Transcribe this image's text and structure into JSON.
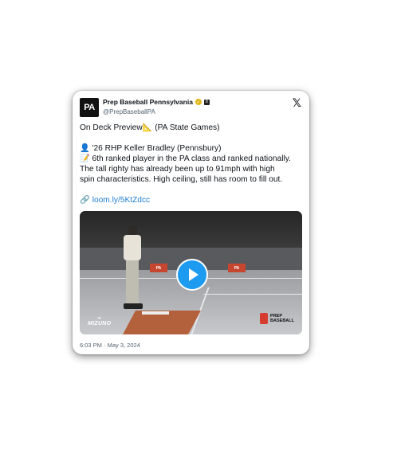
{
  "tweet": {
    "display_name": "Prep Baseball Pennsylvania",
    "handle": "@PrepBaseballPA",
    "avatar_text": "PA",
    "verified_icon": "verified-badge-icon",
    "affiliate_badge_text": "8",
    "x_logo": "𝕏",
    "lines": [
      "On Deck Preview📐 (PA State Games)",
      "👤 '26 RHP Keller Bradley (Pennsbury)",
      "📝 6th ranked player in the PA class and ranked nationally.",
      "The tall righty has already been up to 91mph with high",
      "spin characteristics. High ceiling, still has room to fill out."
    ],
    "link_icon": "🔗",
    "link_text": "loom.ly/5KtZdcc",
    "video": {
      "sign_text": "PA",
      "mizuno_text": "MIZUNO",
      "pb_text_1": "PREP",
      "pb_text_2": "BASEBALL"
    },
    "timestamp": "6:03 PM · May 3, 2024"
  },
  "colors": {
    "accent": "#1d9bf0",
    "link": "#1d7fd1",
    "verified": "#e2b719",
    "muted": "#536471"
  }
}
